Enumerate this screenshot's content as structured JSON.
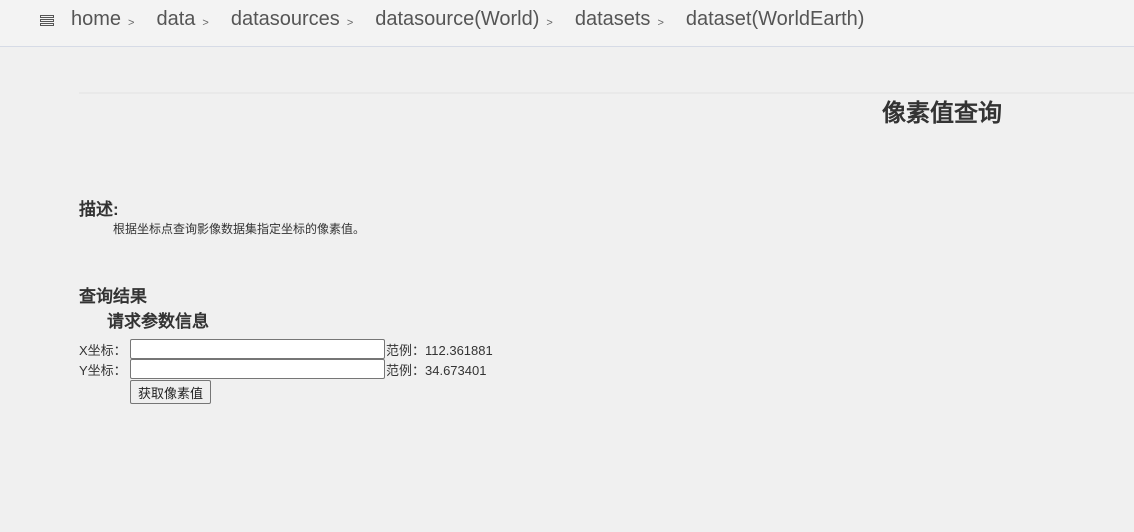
{
  "breadcrumb": {
    "items": [
      "home",
      "data",
      "datasources",
      "datasource(World)",
      "datasets",
      "dataset(WorldEarth)"
    ],
    "separator": ">"
  },
  "page": {
    "title": "像素值查询"
  },
  "description": {
    "heading": "描述:",
    "text": "根据坐标点查询影像数据集指定坐标的像素值。"
  },
  "results": {
    "heading": "查询结果",
    "params_heading": "请求参数信息"
  },
  "form": {
    "x": {
      "label": "X坐标：",
      "value": "",
      "example": "范例：112.361881"
    },
    "y": {
      "label": "Y坐标：",
      "value": "",
      "example": "范例：34.673401"
    },
    "submit_label": "获取像素值"
  }
}
